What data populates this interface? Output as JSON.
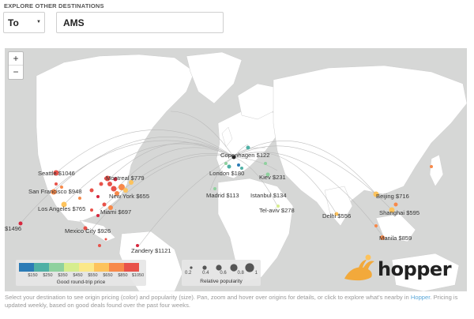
{
  "header": {
    "section_label": "EXPLORE OTHER DESTINATIONS"
  },
  "direction_select": {
    "value": "To"
  },
  "destination_input": {
    "value": "AMS"
  },
  "map": {
    "zoom_in_label": "+",
    "zoom_out_label": "−",
    "origin_hub": "London $180",
    "city_labels": [
      {
        "key": "seattle",
        "text": "Seattle $1046"
      },
      {
        "key": "san-francisco",
        "text": "San Francisco $948"
      },
      {
        "key": "los-angeles",
        "text": "Los Angeles $765"
      },
      {
        "key": "honolulu",
        "text": "$1496"
      },
      {
        "key": "mexico-city",
        "text": "Mexico City $926"
      },
      {
        "key": "montreal",
        "text": "Montreal $779"
      },
      {
        "key": "new-york",
        "text": "New York $655"
      },
      {
        "key": "miami",
        "text": "Miami $697"
      },
      {
        "key": "zandery",
        "text": "Zandery $1121"
      },
      {
        "key": "copenhagen",
        "text": "Copenhagen $122"
      },
      {
        "key": "london",
        "text": "London $180"
      },
      {
        "key": "kiev",
        "text": "Kiev $231"
      },
      {
        "key": "madrid",
        "text": "Madrid $113"
      },
      {
        "key": "istanbul",
        "text": "Istanbul $134"
      },
      {
        "key": "tel-aviv",
        "text": "Tel-aviv $278"
      },
      {
        "key": "delhi",
        "text": "Delhi $556"
      },
      {
        "key": "beijing",
        "text": "Beijing $716"
      },
      {
        "key": "shanghai",
        "text": "Shanghai $595"
      },
      {
        "key": "manila",
        "text": "Manila $859"
      }
    ]
  },
  "price_legend": {
    "title": "Good round-trip price",
    "colors": [
      "#2c7bb6",
      "#4fb0a5",
      "#8fd19e",
      "#d6ed8e",
      "#fbe889",
      "#fdc35c",
      "#f7894a",
      "#e8524a",
      "#d7263d"
    ],
    "ticks": [
      "$150",
      "$250",
      "$350",
      "$450",
      "$550",
      "$650",
      "$850",
      "$1050"
    ]
  },
  "popularity_legend": {
    "title": "Relative popularity",
    "values": [
      "0.2",
      "0.4",
      "0.6",
      "0.8",
      "1"
    ]
  },
  "brand": {
    "name": "hopper"
  },
  "footer": {
    "text_before_link": "Select your destination to see origin pricing (color) and popularity (size). Pan, zoom and hover over origins for details, or click to explore what's nearby in",
    "link_text": "Hopper",
    "text_after_link": ". Pricing is updated weekly, based on good deals found over the past four weeks."
  }
}
